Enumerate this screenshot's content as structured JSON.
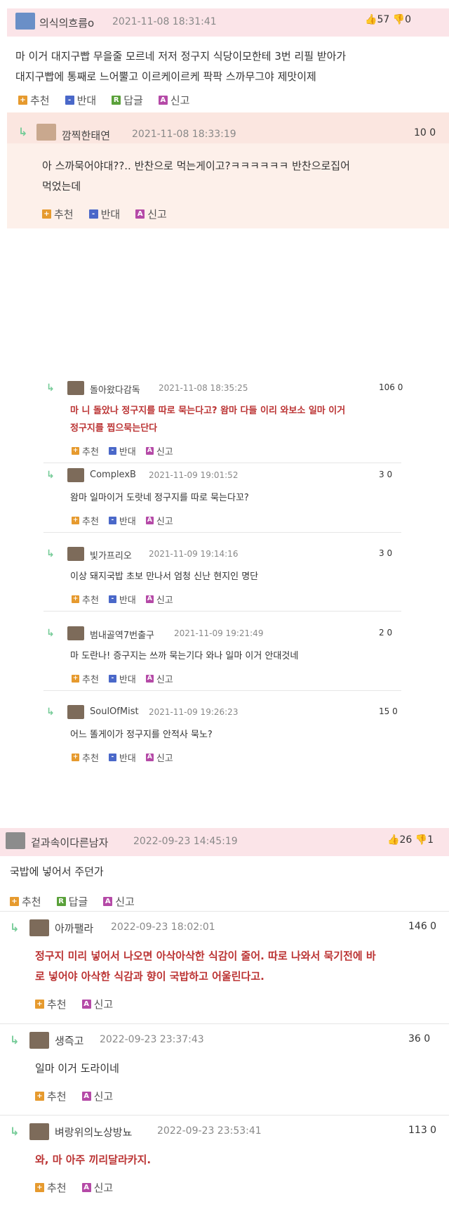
{
  "comments": [
    {
      "nick": "의식의흐름o",
      "date": "2021-11-08 18:31:41",
      "up": "57",
      "down": "0",
      "text": [
        "마 이거 대지구빱 무을줄 모르네 저저 정구지 식당이모한테 3번 리필 받아가",
        "대지구빱에 통째로 느어뿔고 이르케이르케 팍팍 스까무그야 제맛이제"
      ],
      "actions": [
        "추천",
        "반대",
        "답글",
        "신고"
      ]
    },
    {
      "nick": "깜찍한태연",
      "date": "2021-11-08 18:33:19",
      "votes": "10 0",
      "text": [
        "아 스까묵어야대??.. 반찬으로 먹는게이고?ㅋㅋㅋㅋㅋㅋ 반찬으로집어",
        "먹었는데"
      ],
      "actions": [
        "추천",
        "반대",
        "신고"
      ]
    }
  ],
  "sub_thread": [
    {
      "nick": "돌아왔다감독",
      "date": "2021-11-08 18:35:25",
      "votes": "106 0",
      "text": [
        "마 니 돌았나 정구지를 따로 묵는다고? 왐마 다들 이리 와보소 일마 이거",
        "정구지를 찝으묵는단다"
      ],
      "red": true
    },
    {
      "nick": "ComplexB",
      "date": "2021-11-09 19:01:52",
      "votes": "3 0",
      "text": [
        "왐마 일마이거 도랏네 정구지를 따로 묵는다꼬?"
      ],
      "red": false
    },
    {
      "nick": "빛가프리오",
      "date": "2021-11-09 19:14:16",
      "votes": "3 0",
      "text": [
        "이상 돼지국밥 초보 만나서 엄청 신난 현지인 명단"
      ],
      "red": false
    },
    {
      "nick": "범내골역7번출구",
      "date": "2021-11-09 19:21:49",
      "votes": "2 0",
      "text": [
        "마 도란나! 증구지는 쓰까 묵는기다 와나 일마 이거 안대것네"
      ],
      "red": false
    },
    {
      "nick": "SoulOfMist",
      "date": "2021-11-09 19:26:23",
      "votes": "15 0",
      "text": [
        "어느 똘게이가 정구지를 안적사 묵노?"
      ],
      "red": false
    }
  ],
  "sub_actions": [
    "추천",
    "반대",
    "신고"
  ],
  "second": {
    "nick": "겉과속이다른남자",
    "date": "2022-09-23 14:45:19",
    "up": "26",
    "down": "1",
    "text": "국밥에 넣어서 주던가",
    "actions": [
      "추천",
      "답글",
      "신고"
    ]
  },
  "replies2": [
    {
      "nick": "아까팰라",
      "date": "2022-09-23 18:02:01",
      "votes": "146 0",
      "text": [
        "정구지 미리 넣어서 나오면 아삭아삭한 식감이 줄어. 따로 나와서 묵기전에 바",
        "로 넣어야 아삭한 식감과 향이 국밥하고 어울린다고."
      ],
      "red": true
    },
    {
      "nick": "생즉고",
      "date": "2022-09-23 23:37:43",
      "votes": "36 0",
      "text": [
        "일마 이거 도라이네"
      ],
      "red": false
    },
    {
      "nick": "벼랑위의노상방뇨",
      "date": "2022-09-23 23:53:41",
      "votes": "113 0",
      "text": [
        "와, 마 아주 끼리달라카지."
      ],
      "red": true
    }
  ],
  "replies2_actions": [
    "추천",
    "신고"
  ],
  "colors": {
    "header_pink": "#fbe4e8",
    "body_cream": "#fdf0ea",
    "red_text": "#b33333",
    "plus": "#e69a2e",
    "minus": "#4a68c9",
    "reply": "#5aa13a",
    "report": "#b54aa7"
  },
  "icons": {
    "thumb_up": "thumb-up-icon",
    "thumb_down": "thumb-down-icon",
    "reply_arrow": "reply-arrow-icon"
  }
}
